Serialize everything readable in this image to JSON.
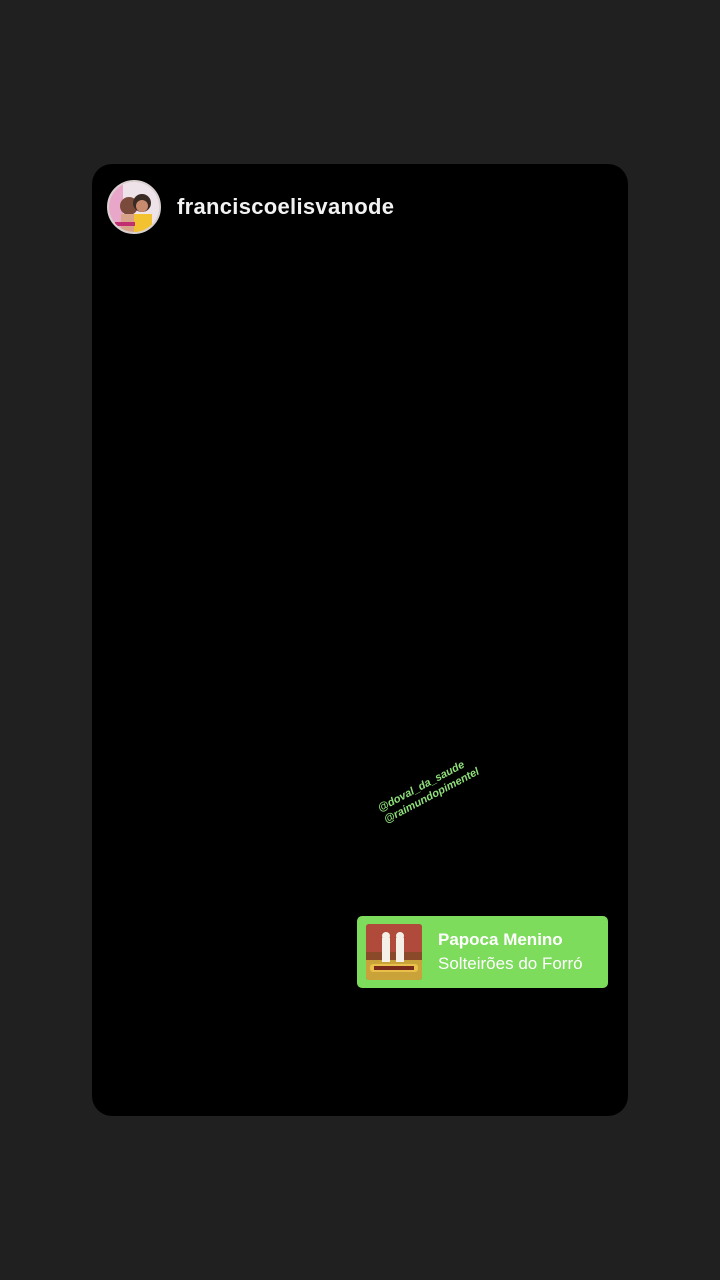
{
  "story": {
    "username": "franciscoelisvanode",
    "avatar_icon": "profile-photo",
    "mentions": [
      "@doval_da_saude",
      "@raimundopimentel"
    ],
    "mention_color": "#8fe07b",
    "music": {
      "title": "Papoca Menino",
      "artist": "Solteirões do Forró",
      "sticker_color": "#7ddc5c"
    }
  },
  "colors": {
    "background": "#212021",
    "card": "#000000"
  }
}
